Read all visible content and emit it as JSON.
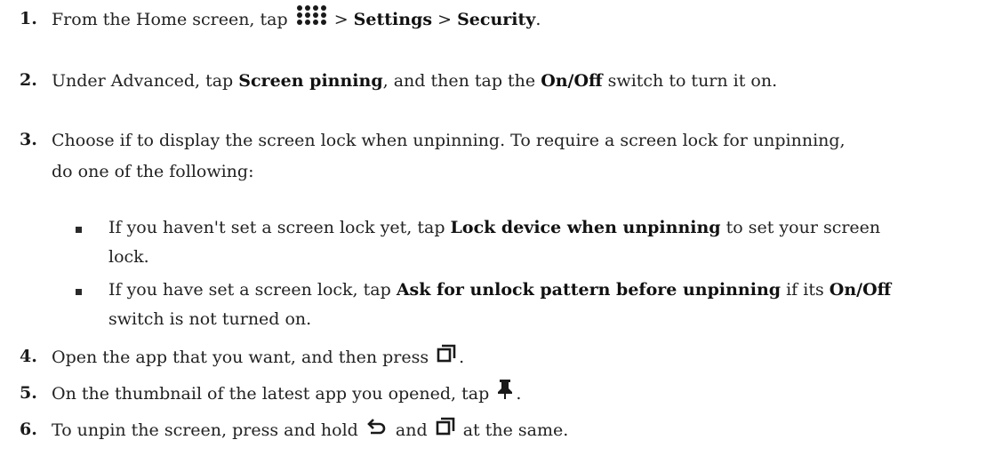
{
  "steps": [
    {
      "number": "1.",
      "parts": [
        "From the Home screen, tap ",
        " > ",
        " > ",
        "."
      ],
      "bold": [
        "Settings",
        "Security"
      ],
      "icon": "apps-grid-icon"
    },
    {
      "number": "2.",
      "parts": [
        "Under Advanced, tap ",
        ", and then tap the ",
        " switch to turn it on."
      ],
      "bold": [
        "Screen pinning",
        "On/Off"
      ]
    },
    {
      "number": "3.",
      "line1": "Choose if to display the screen lock when unpinning. To require a screen lock for unpinning,",
      "line2": "do one of the following:",
      "bullets": [
        {
          "parts": [
            "If you haven't set a screen lock yet, tap ",
            " to set your screen"
          ],
          "bold": [
            "Lock device when unpinning"
          ],
          "line2": "lock."
        },
        {
          "parts": [
            "If you have set a screen lock, tap ",
            " if its ",
            ""
          ],
          "bold": [
            "Ask for unlock pattern before unpinning",
            "On/Off"
          ],
          "line2": "switch is not turned on."
        }
      ]
    },
    {
      "number": "4.",
      "parts": [
        "Open the app that you want, and then press ",
        "."
      ],
      "icon": "recent-apps-icon"
    },
    {
      "number": "5.",
      "parts": [
        "On the thumbnail of the latest app you opened, tap ",
        "."
      ],
      "icon": "pin-icon"
    },
    {
      "number": "6.",
      "parts": [
        "To unpin the screen, press and hold ",
        " and ",
        " at the same."
      ],
      "icons": [
        "back-icon",
        "recent-apps-icon"
      ]
    }
  ]
}
